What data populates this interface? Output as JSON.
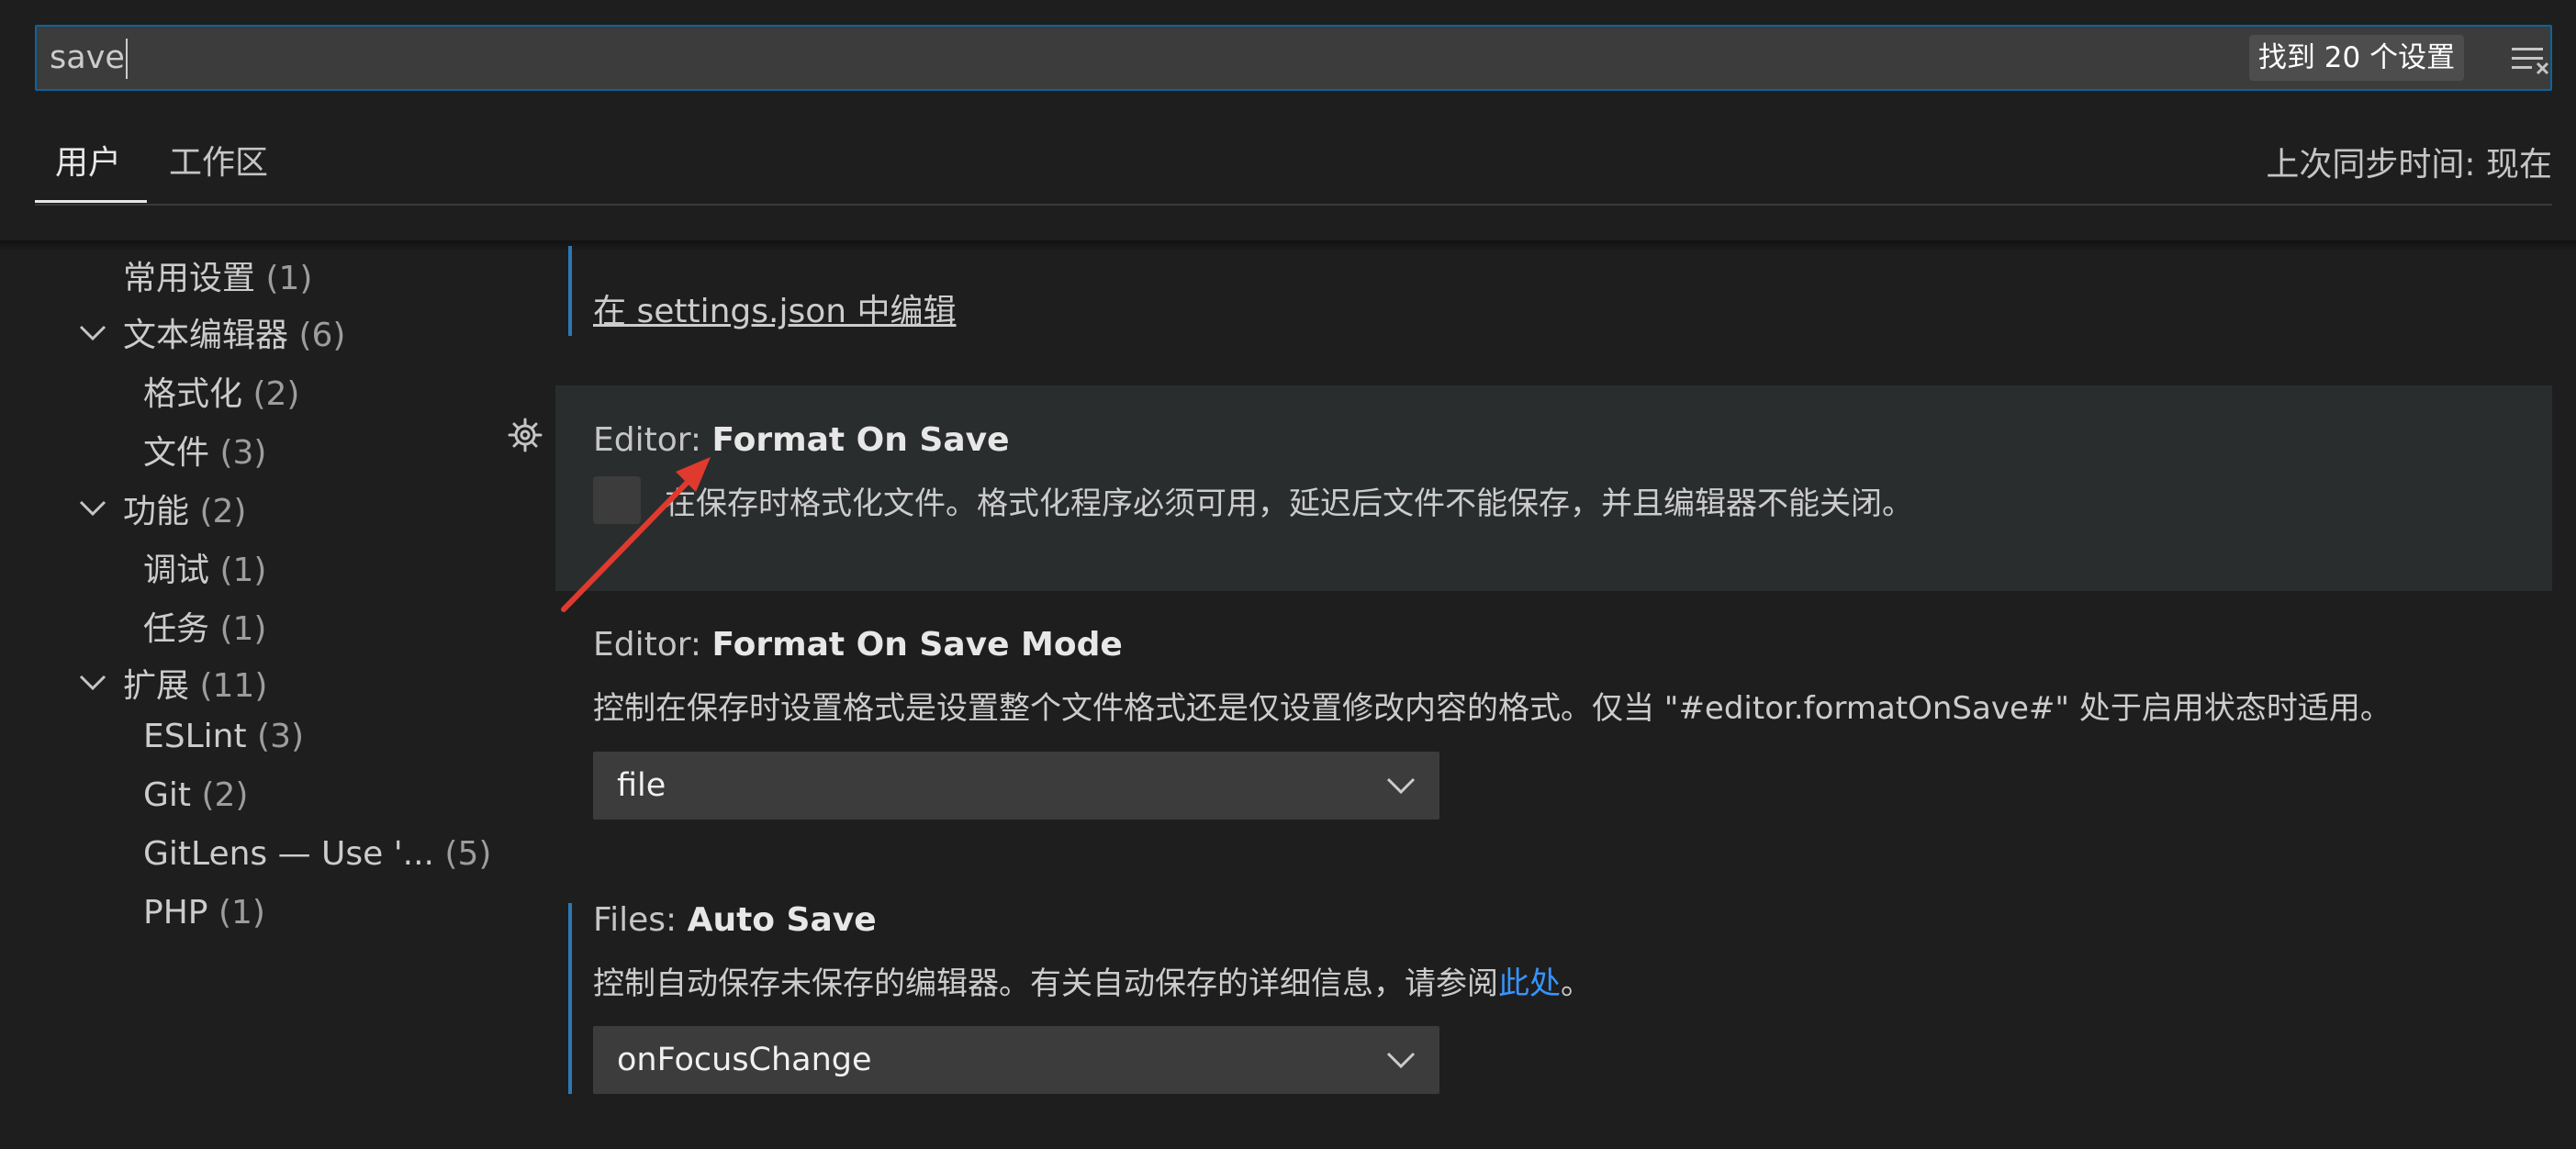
{
  "search": {
    "value": "save",
    "result_count": "找到 20 个设置",
    "clear_icon": "clear-filter-icon"
  },
  "tabs": [
    {
      "label": "用户",
      "active": true
    },
    {
      "label": "工作区",
      "active": false
    }
  ],
  "sync_status": "上次同步时间: 现在",
  "toc": [
    {
      "label": "常用设置",
      "count": "(1)"
    },
    {
      "label": "文本编辑器",
      "count": "(6)",
      "expanded": true
    },
    {
      "label": "格式化",
      "count": "(2)"
    },
    {
      "label": "文件",
      "count": "(3)"
    },
    {
      "label": "功能",
      "count": "(2)",
      "expanded": true
    },
    {
      "label": "调试",
      "count": "(1)"
    },
    {
      "label": "任务",
      "count": "(1)"
    },
    {
      "label": "扩展",
      "count": "(11)",
      "expanded": true
    },
    {
      "label": "ESLint",
      "count": "(3)"
    },
    {
      "label": "Git",
      "count": "(2)"
    },
    {
      "label": "GitLens — Use '...",
      "count": "(5)"
    },
    {
      "label": "PHP",
      "count": "(1)"
    }
  ],
  "edit_json_link": "在 settings.json 中编辑",
  "settings": [
    {
      "category": "Editor: ",
      "name": "Format On Save",
      "description": "在保存时格式化文件。格式化程序必须可用，延迟后文件不能保存，并且编辑器不能关闭。",
      "checked": false
    },
    {
      "category": "Editor: ",
      "name": "Format On Save Mode",
      "description": "控制在保存时设置格式是设置整个文件格式还是仅设置修改内容的格式。仅当 \"#editor.formatOnSave#\" 处于启用状态时适用。",
      "value": "file"
    },
    {
      "category": "Files: ",
      "name": "Auto Save",
      "description": "控制自动保存未保存的编辑器。有关自动保存的详细信息，请参阅",
      "link": "此处",
      "description_end": "。",
      "value": "onFocusChange"
    }
  ],
  "colors": {
    "background": "#1e1e1e",
    "input_background": "#3c3c3c",
    "focus_border": "#0e639c",
    "link": "#3794ff",
    "annotation_arrow": "#e03a2f"
  }
}
